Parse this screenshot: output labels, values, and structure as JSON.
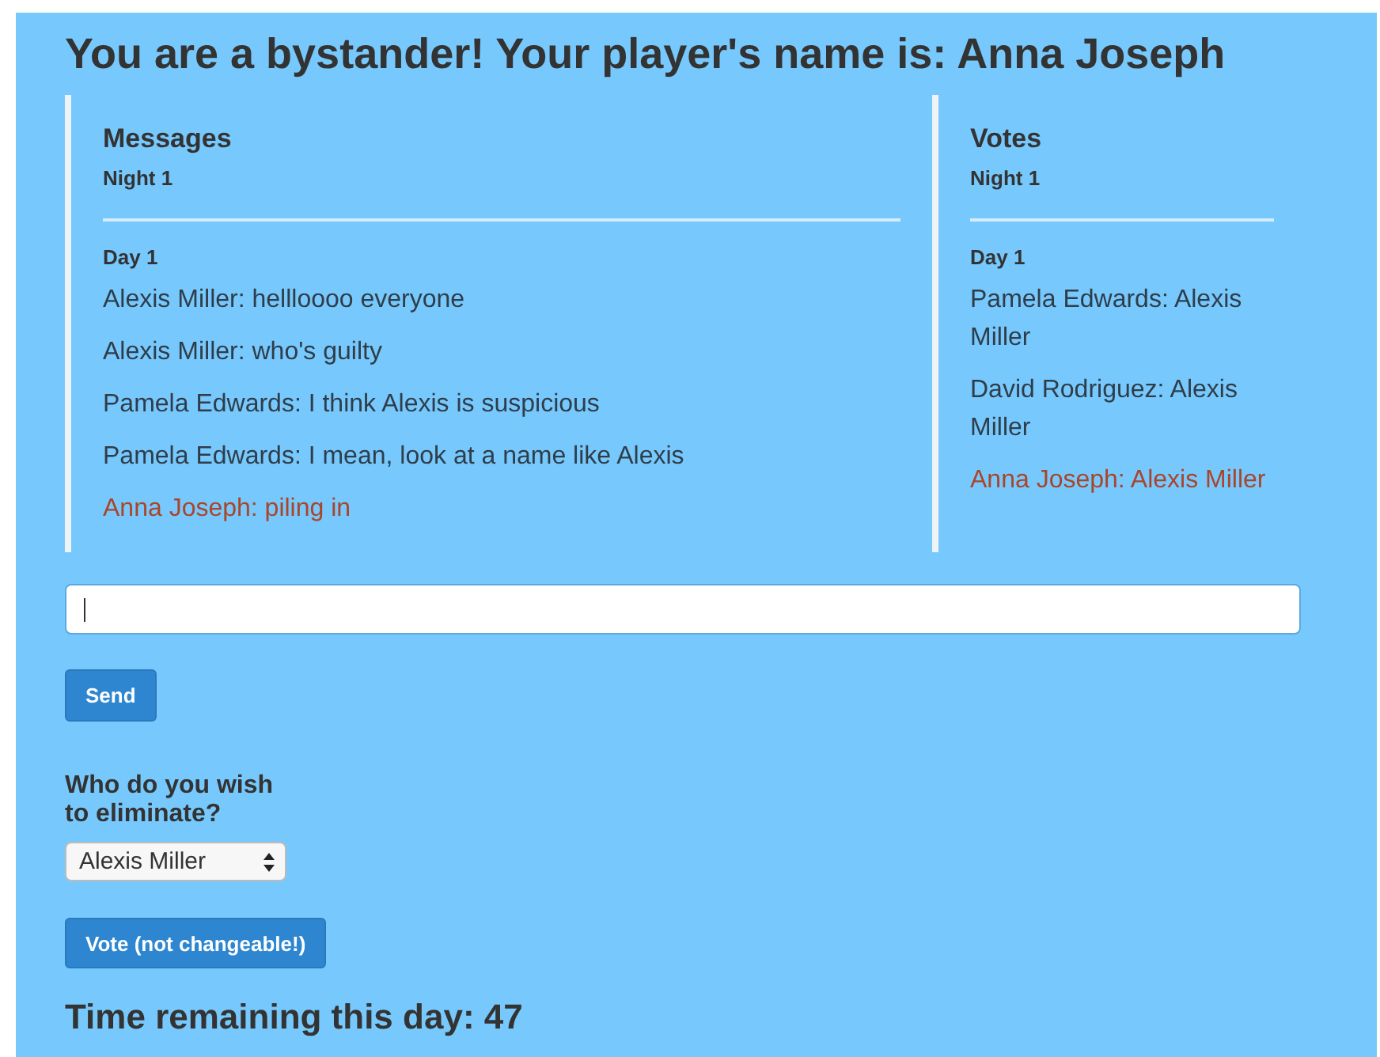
{
  "heading": "You are a bystander! Your player's name is: Anna Joseph",
  "messages": {
    "title": "Messages",
    "sections": [
      {
        "label": "Night 1"
      },
      {
        "label": "Day 1",
        "entries": [
          {
            "text": "Alexis Miller: hellloooo everyone",
            "own": false
          },
          {
            "text": "Alexis Miller: who's guilty",
            "own": false
          },
          {
            "text": "Pamela Edwards: I think Alexis is suspicious",
            "own": false
          },
          {
            "text": "Pamela Edwards: I mean, look at a name like Alexis",
            "own": false
          },
          {
            "text": "Anna Joseph: piling in",
            "own": true
          }
        ]
      }
    ]
  },
  "votes": {
    "title": "Votes",
    "sections": [
      {
        "label": "Night 1"
      },
      {
        "label": "Day 1",
        "entries": [
          {
            "text": "Pamela Edwards: Alexis Miller",
            "own": false
          },
          {
            "text": "David Rodriguez: Alexis Miller",
            "own": false
          },
          {
            "text": "Anna Joseph: Alexis Miller",
            "own": true
          }
        ]
      }
    ]
  },
  "send_button": "Send",
  "vote_prompt": "Who do you wish to eliminate?",
  "vote_select": {
    "value": "Alexis Miller"
  },
  "vote_button": "Vote (not changeable!)",
  "time_remaining": "Time remaining this day: 47"
}
